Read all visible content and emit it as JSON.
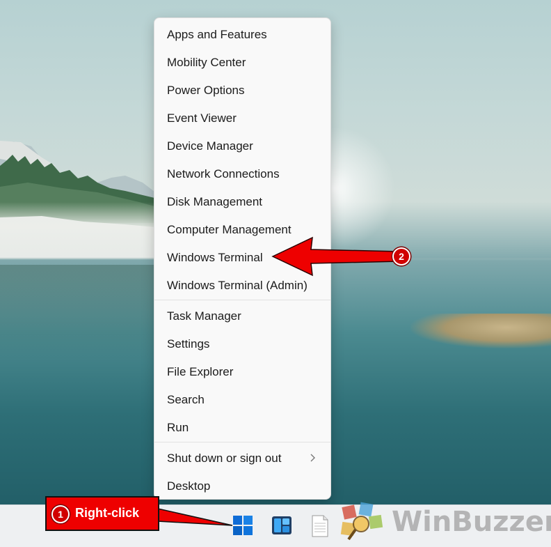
{
  "context_menu": {
    "items": [
      {
        "label": "Apps and Features"
      },
      {
        "label": "Mobility Center"
      },
      {
        "label": "Power Options"
      },
      {
        "label": "Event Viewer"
      },
      {
        "label": "Device Manager"
      },
      {
        "label": "Network Connections"
      },
      {
        "label": "Disk Management"
      },
      {
        "label": "Computer Management"
      },
      {
        "label": "Windows Terminal"
      },
      {
        "label": "Windows Terminal (Admin)"
      },
      {
        "label": "Task Manager"
      },
      {
        "label": "Settings"
      },
      {
        "label": "File Explorer"
      },
      {
        "label": "Search"
      },
      {
        "label": "Run"
      },
      {
        "label": "Shut down or sign out",
        "submenu": true
      },
      {
        "label": "Desktop"
      }
    ]
  },
  "annotations": {
    "step1_number": "1",
    "step1_label": "Right-click",
    "step2_number": "2",
    "callout_color": "#ee0000"
  },
  "taskbar": {
    "icons": [
      "start-icon",
      "widgets-icon",
      "notepad-icon"
    ],
    "accent_color": "#0078d4"
  },
  "watermark": {
    "text": "WinBuzzer"
  }
}
